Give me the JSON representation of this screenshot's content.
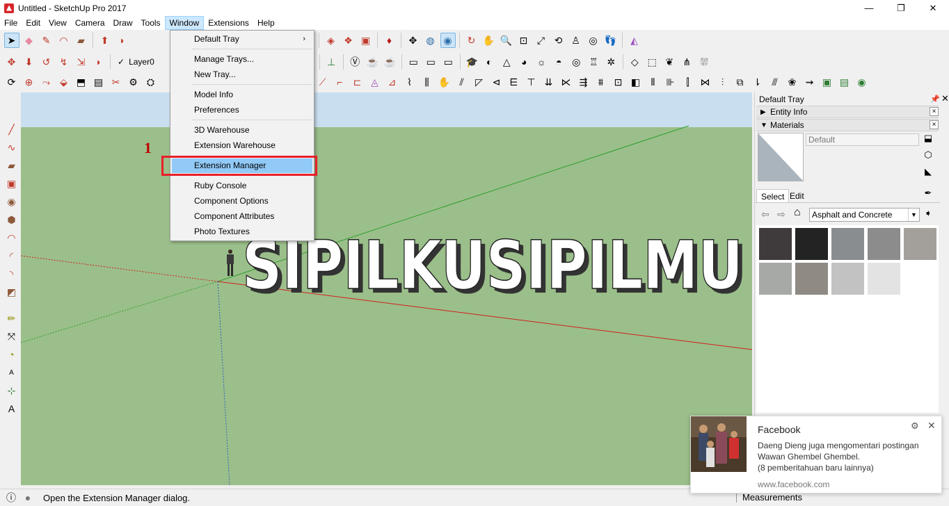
{
  "window": {
    "title": "Untitled - SketchUp Pro 2017",
    "minimize": "—",
    "maximize": "❐",
    "close": "✕"
  },
  "menubar": {
    "items": [
      "File",
      "Edit",
      "View",
      "Camera",
      "Draw",
      "Tools",
      "Window",
      "Extensions",
      "Help"
    ],
    "active": "Window"
  },
  "toolbar2": {
    "layer_check": "✓",
    "layer_name": "Layer0"
  },
  "window_menu": {
    "default_tray": "Default Tray",
    "submenu_arrow": "›",
    "manage_trays": "Manage Trays...",
    "new_tray": "New Tray...",
    "model_info": "Model Info",
    "preferences": "Preferences",
    "warehouse_3d": "3D Warehouse",
    "extension_warehouse": "Extension Warehouse",
    "extension_manager": "Extension Manager",
    "ruby_console": "Ruby Console",
    "component_options": "Component Options",
    "component_attributes": "Component Attributes",
    "photo_textures": "Photo Textures"
  },
  "annotation": {
    "step_number": "1",
    "highlight_color": "#e8202a"
  },
  "viewport": {
    "text_3d": "SIPILKUSIPILMU",
    "sky_color": "#c9dff0",
    "ground_color": "#9bbf8a"
  },
  "tray": {
    "title": "Default Tray",
    "pin": "📌",
    "close": "✕",
    "entity_info": "Entity Info",
    "materials": "Materials",
    "panel_close": "×",
    "expanded_arrow": "▼",
    "collapsed_arrow": "▶",
    "material_name_placeholder": "Default",
    "tab_select": "Select",
    "tab_edit": "Edit",
    "library": "Asphalt and Concrete",
    "dropdown_arrow": "▼",
    "nav_back": "⇦",
    "nav_forward": "⇨",
    "home": "⌂",
    "swatch_colors": [
      "#3f3b3c",
      "#232323",
      "#8a8d90",
      "#8c8c8c",
      "#a39f9a",
      "#a6a9a6",
      "#8f8a84",
      "#c2c2c2",
      "#e3e3e3"
    ]
  },
  "statusbar": {
    "info_icon": "ⓘ",
    "user_icon": "●",
    "message": "Open the Extension Manager dialog.",
    "measurements": "Measurements"
  },
  "notification": {
    "app": "Facebook",
    "message": "Daeng Dieng juga mengomentari postingan Wawan Ghembel Ghembel.",
    "more": "(8 pemberitahuan baru lainnya)",
    "url": "www.facebook.com",
    "gear": "⚙",
    "close": "✕"
  }
}
